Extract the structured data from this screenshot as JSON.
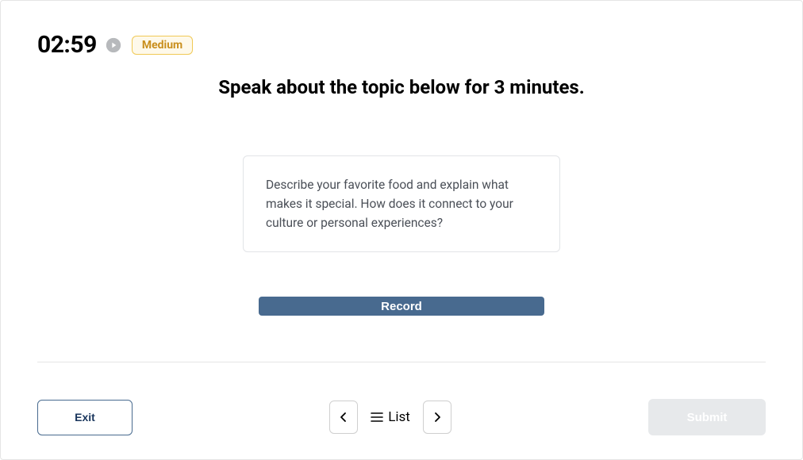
{
  "header": {
    "timer": "02:59",
    "difficulty": "Medium"
  },
  "instruction": "Speak about the topic below for 3 minutes.",
  "prompt": "Describe your favorite food and explain what makes it special. How does it connect to your culture or personal experiences?",
  "buttons": {
    "record": "Record",
    "exit": "Exit",
    "list": "List",
    "submit": "Submit"
  },
  "colors": {
    "accent": "#486a8f",
    "badgeBorder": "#f0c955",
    "badgeText": "#c98f1d",
    "badgeBg": "#fef9ea"
  }
}
